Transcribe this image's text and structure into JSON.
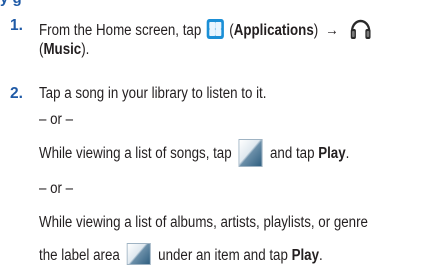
{
  "steps": [
    {
      "number": "1.",
      "text_before": "From the Home screen, tap",
      "apps_label": "Applications",
      "music_label": "Music"
    },
    {
      "number": "2.",
      "line1": "Tap a song in your library to listen to it.",
      "or1": "– or –",
      "alt1_before": "While viewing a list of songs, tap",
      "alt1_after": "and tap",
      "alt1_bold": "Play",
      "or2": "– or –",
      "alt2_line1": "While viewing a list of albums, artists, playlists, or genre",
      "alt2_before": "the label area",
      "alt2_after": "under an item and tap",
      "alt2_bold": "Play"
    }
  ],
  "icons": {
    "applications": "apps-grid-icon",
    "music": "headphones-icon",
    "song_thumbnail": "song-thumbnail-icon"
  },
  "colors": {
    "step_number": "#1f5aa6",
    "apps_icon": "#1b8fd6",
    "text": "#231f20"
  }
}
